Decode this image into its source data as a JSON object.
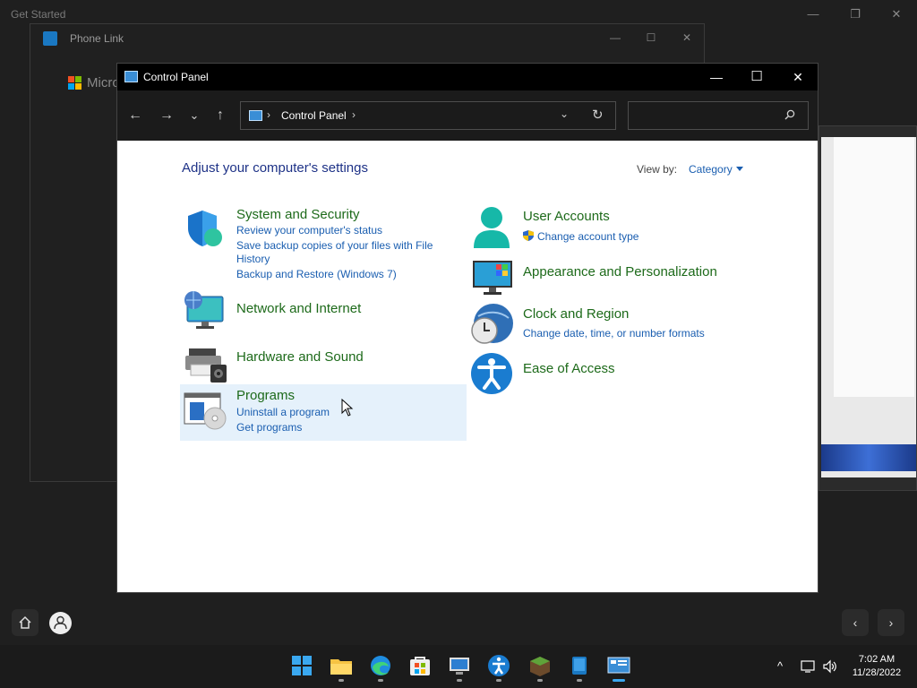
{
  "background": {
    "get_started_title": "Get Started",
    "phone_link_title": "Phone Link",
    "microsoft_text": "Micro"
  },
  "window": {
    "title": "Control Panel",
    "minimize": "—",
    "maximize": "☐",
    "close": "✕"
  },
  "nav": {
    "back": "←",
    "forward": "→",
    "recent": "⌄",
    "up": "↑",
    "address_separator": "›",
    "address_text": "Control Panel",
    "address_dropdown": "⌄",
    "refresh": "↻",
    "search_placeholder": ""
  },
  "body": {
    "heading": "Adjust your computer's settings",
    "view_by_label": "View by:",
    "view_by_value": "Category"
  },
  "categories_left": [
    {
      "title": "System and Security",
      "links": [
        "Review your computer's status",
        "Save backup copies of your files with File",
        "History",
        "Backup and Restore (Windows 7)"
      ]
    },
    {
      "title": "Network and Internet",
      "links": []
    },
    {
      "title": "Hardware and Sound",
      "links": []
    },
    {
      "title": "Programs",
      "links": [
        "Uninstall a program",
        "Get programs"
      ]
    }
  ],
  "categories_right": [
    {
      "title": "User Accounts",
      "links": [
        "Change account type"
      ]
    },
    {
      "title": "Appearance and Personalization",
      "links": []
    },
    {
      "title": "Clock and Region",
      "links": [
        "Change date, time, or number formats"
      ]
    },
    {
      "title": "Ease of Access",
      "links": []
    }
  ],
  "dock": {
    "prev": "‹",
    "next": "›"
  },
  "taskbar": {
    "tray_chevron": "^",
    "time": "7:02 AM",
    "date": "11/28/2022"
  },
  "colors": {
    "category_title": "#1d6a1a",
    "link": "#1a5eb0",
    "heading": "#1e3287",
    "titlebar": "#000000",
    "hover": "#e5f1fb"
  }
}
